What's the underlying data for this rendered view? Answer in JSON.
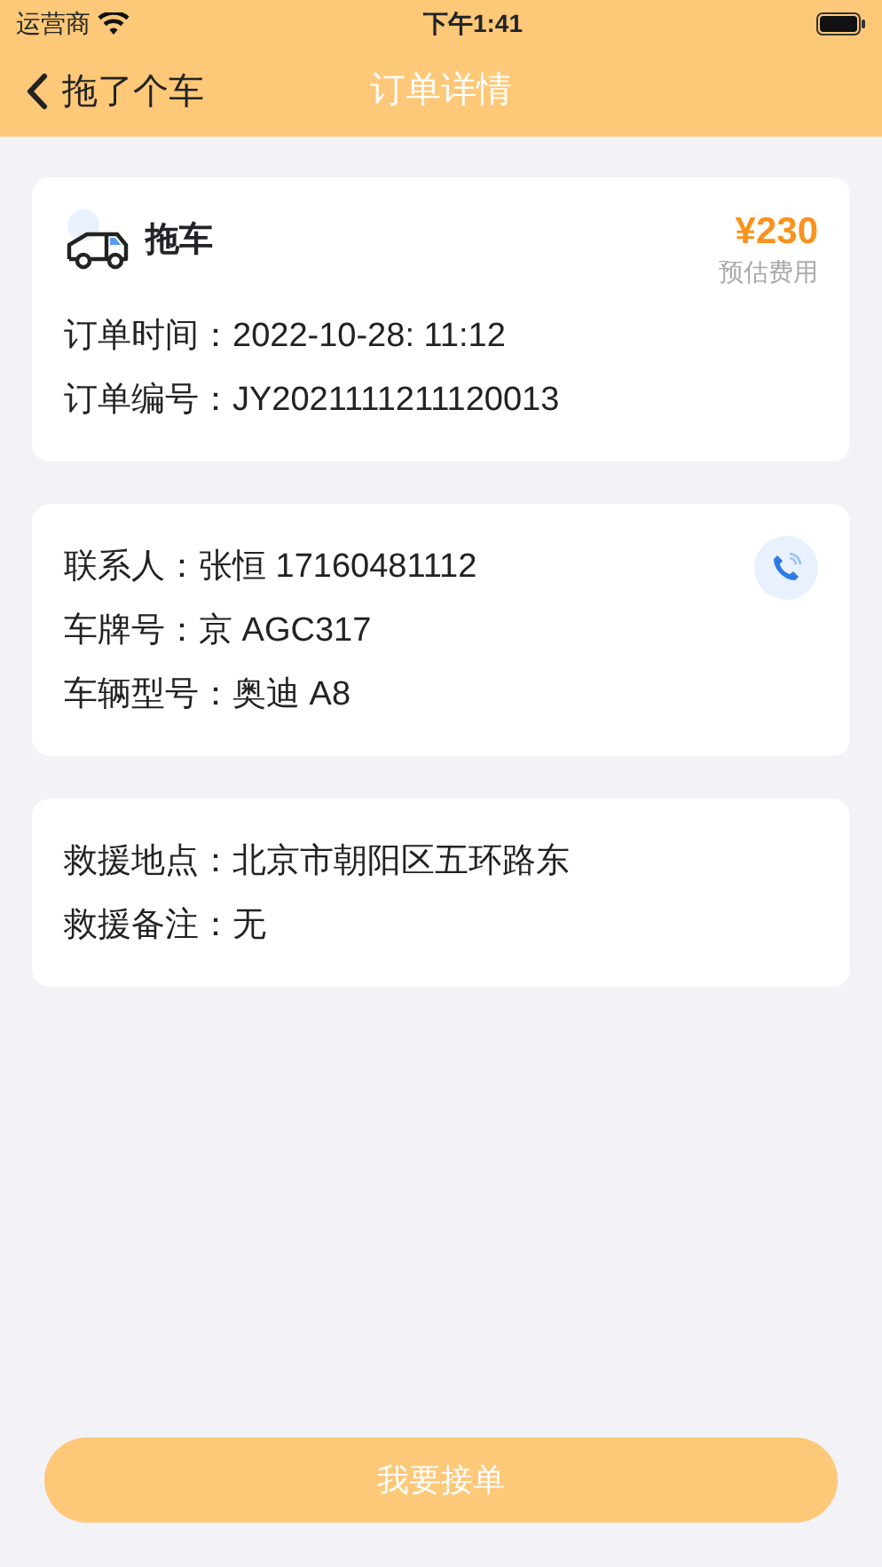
{
  "status_bar": {
    "carrier": "运营商",
    "time": "下午1:41"
  },
  "nav_bar": {
    "back_label": "拖了个车",
    "title": "订单详情"
  },
  "service_card": {
    "service": "拖车",
    "price": "¥230",
    "price_caption": "预估费用",
    "fields": [
      {
        "label": "订单时间：",
        "value": "2022-10-28: 11:12"
      },
      {
        "label": "订单编号：",
        "value": "JY2021111211120013"
      }
    ]
  },
  "contact_card": {
    "fields": [
      {
        "label": "联系人：",
        "value": "张恒 17160481112"
      },
      {
        "label": "车牌号：",
        "value": "京 AGC317"
      },
      {
        "label": "车辆型号：",
        "value": "奥迪 A8"
      }
    ]
  },
  "rescue_card": {
    "fields": [
      {
        "label": "救援地点：",
        "value": "北京市朝阳区五环路东"
      },
      {
        "label": "救援备注：",
        "value": "无"
      }
    ]
  },
  "action_button": {
    "label": "我要接单"
  }
}
